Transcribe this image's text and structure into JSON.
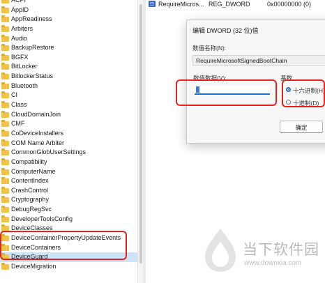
{
  "registry_tree": {
    "items": [
      {
        "label": "ACPI"
      },
      {
        "label": "AppID"
      },
      {
        "label": "AppReadiness"
      },
      {
        "label": "Arbiters"
      },
      {
        "label": "Audio"
      },
      {
        "label": "BackupRestore"
      },
      {
        "label": "BGFX"
      },
      {
        "label": "BitLocker"
      },
      {
        "label": "BitlockerStatus"
      },
      {
        "label": "Bluetooth"
      },
      {
        "label": "CI"
      },
      {
        "label": "Class"
      },
      {
        "label": "CloudDomainJoin"
      },
      {
        "label": "CMF"
      },
      {
        "label": "CoDeviceInstallers"
      },
      {
        "label": "COM Name Arbiter"
      },
      {
        "label": "CommonGlobUserSettings"
      },
      {
        "label": "Compatibility"
      },
      {
        "label": "ComputerName"
      },
      {
        "label": "ContentIndex"
      },
      {
        "label": "CrashControl"
      },
      {
        "label": "Cryptography"
      },
      {
        "label": "DebugRegSvc"
      },
      {
        "label": "DeveloperToolsConfig"
      },
      {
        "label": "DeviceClasses"
      },
      {
        "label": "DeviceContainerPropertyUpdateEvents"
      },
      {
        "label": "DeviceContainers"
      },
      {
        "label": "DeviceGuard"
      },
      {
        "label": "DeviceMigration"
      }
    ],
    "selected": "DeviceGuard"
  },
  "value_list": {
    "rows": [
      {
        "name": "RequireMicros...",
        "type": "REG_DWORD",
        "data": "0x00000000 (0)"
      }
    ]
  },
  "dialog": {
    "title": "编辑 DWORD (32 位)值",
    "value_name_label": "数值名称(N):",
    "value_name": "RequireMicrosoftSignedBootChain",
    "value_data_label": "数值数据(V):",
    "value_data": "0",
    "base_label": "基数",
    "hex_label": "十六进制(H)",
    "dec_label": "十进制(D)",
    "base_selected": "hex",
    "ok_label": "确定"
  },
  "watermark": {
    "title": "当下软件园",
    "url": "www.downxia.com"
  },
  "colors": {
    "highlight": "#e52420",
    "accent": "#1f6fc5",
    "folder": "#f0c24a"
  }
}
